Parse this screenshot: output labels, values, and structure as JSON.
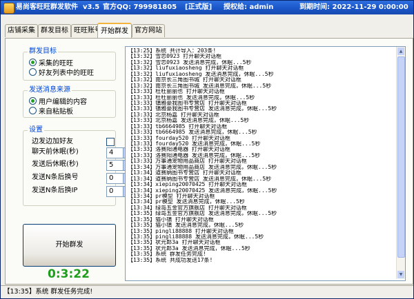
{
  "title": {
    "app_name": "易尚客旺旺群发软件",
    "version": "v3.5",
    "qq": "官方QQ: 799981805",
    "edition": "[正式版]",
    "license": "授权给: admin",
    "expiry": "到期时间: 2022-11-29 0:00:00"
  },
  "tabs": [
    {
      "label": "店铺采集"
    },
    {
      "label": "群发目标"
    },
    {
      "label": "旺旺账号"
    },
    {
      "label": "开始群发"
    },
    {
      "label": "官方网站"
    }
  ],
  "active_tab": "开始群发",
  "target_group": {
    "title": "群发目标",
    "options": [
      "采集的旺旺",
      "好友列表中的旺旺"
    ],
    "selected": "采集的旺旺"
  },
  "source_group": {
    "title": "发送消息来源",
    "options": [
      "用户编辑的内容",
      "来自粘贴板"
    ],
    "selected": "用户编辑的内容"
  },
  "settings": {
    "title": "设置",
    "add_friend_label": "边发边加好友",
    "add_friend_checked": false,
    "chat_sleep_label": "聊天前休眠(秒)",
    "chat_sleep_value": "4",
    "send_sleep_label": "发送后休眠(秒)",
    "send_sleep_value": "5",
    "switch_account_label": "发送N条后换号",
    "switch_account_value": "0",
    "switch_ip_label": "发送N条后换IP",
    "switch_ip_value": "0"
  },
  "start_button": "开始群发",
  "timer": "0:3:22",
  "log": [
    "【13:25】系统 共计导入：203条!",
    "【13:32】雪恋0923 打开聊天对话框",
    "【13:32】雪恋0923 发送消息完成，休眠...5秒",
    "【13:32】liufuxiaosheng 打开聊天对话框",
    "【13:32】liufuxiaosheng 发送消息完成，休眠...5秒",
    "【13:32】南京长三角图书城 打开聊天对话框",
    "【13:32】南京长三角图书城 发送消息完成，休眠...5秒",
    "【13:33】杜杜丽丽也 打开聊天对话框",
    "【13:33】杜杜丽丽也 发送消息完成，休眠...5秒",
    "【13:33】镇雅豪我图书专营店 打开聊天对话框",
    "【13:33】镇雅豪我图书专营店 发送消息完成，休眠...5秒",
    "【13:33】北京杨嘉 打开聊天对话框",
    "【13:33】北京杨嘉 发送消息完成，休眠...5秒",
    "【13:33】tb6664985 打开聊天对话框",
    "【13:33】tb6664985 发送消息完成，休眠...5秒",
    "【13:33】fourday520 打开聊天对话框",
    "【13:33】fourday520 发送消息完成，休眠...5秒",
    "【13:33】洛赛阳通电器 打开聊天对话框",
    "【13:33】洛赛阳通电器 发送消息完成，休眠...5秒",
    "【13:33】万事通宠物用品商店 打开聊天对话框",
    "【13:34】万事通宠物用品商店 发送消息完成，休眠...5秒",
    "【13:34】道赛纳图书专营店 打开聊天对话框",
    "【13:34】道赛纳图书专营店 发送消息完成，休眠...5秒",
    "【13:34】xieping20070425 打开聊天对话框",
    "【13:34】xieping20070425 发送消息完成，休眠...5秒",
    "【13:34】pr模型 打开聊天对话框",
    "【13:34】pr模型 发送消息完成，休眠...5秒",
    "【13:34】绿岛五金官方旗舰店 打开聊天对话框",
    "【13:35】绿岛五金官方旗舰店 发送消息完成，休眠...5秒",
    "【13:35】猫小镇 打开聊天对话框",
    "【13:35】猫小镇 发送消息完成，休眠...5秒",
    "【13:35】pingli88888 打开聊天对话框",
    "【13:35】pingli88888 发送消息完成，休眠...5秒",
    "【13:35】状元郎3a 打开聊天对话框",
    "【13:35】状元郎3a 发送消息完成，休眠...5秒",
    "【13:35】系统 群发任务完成!",
    "【13:35】系统 共成功发送17条!"
  ],
  "status": "【13:35】系统 群发任务完成!"
}
